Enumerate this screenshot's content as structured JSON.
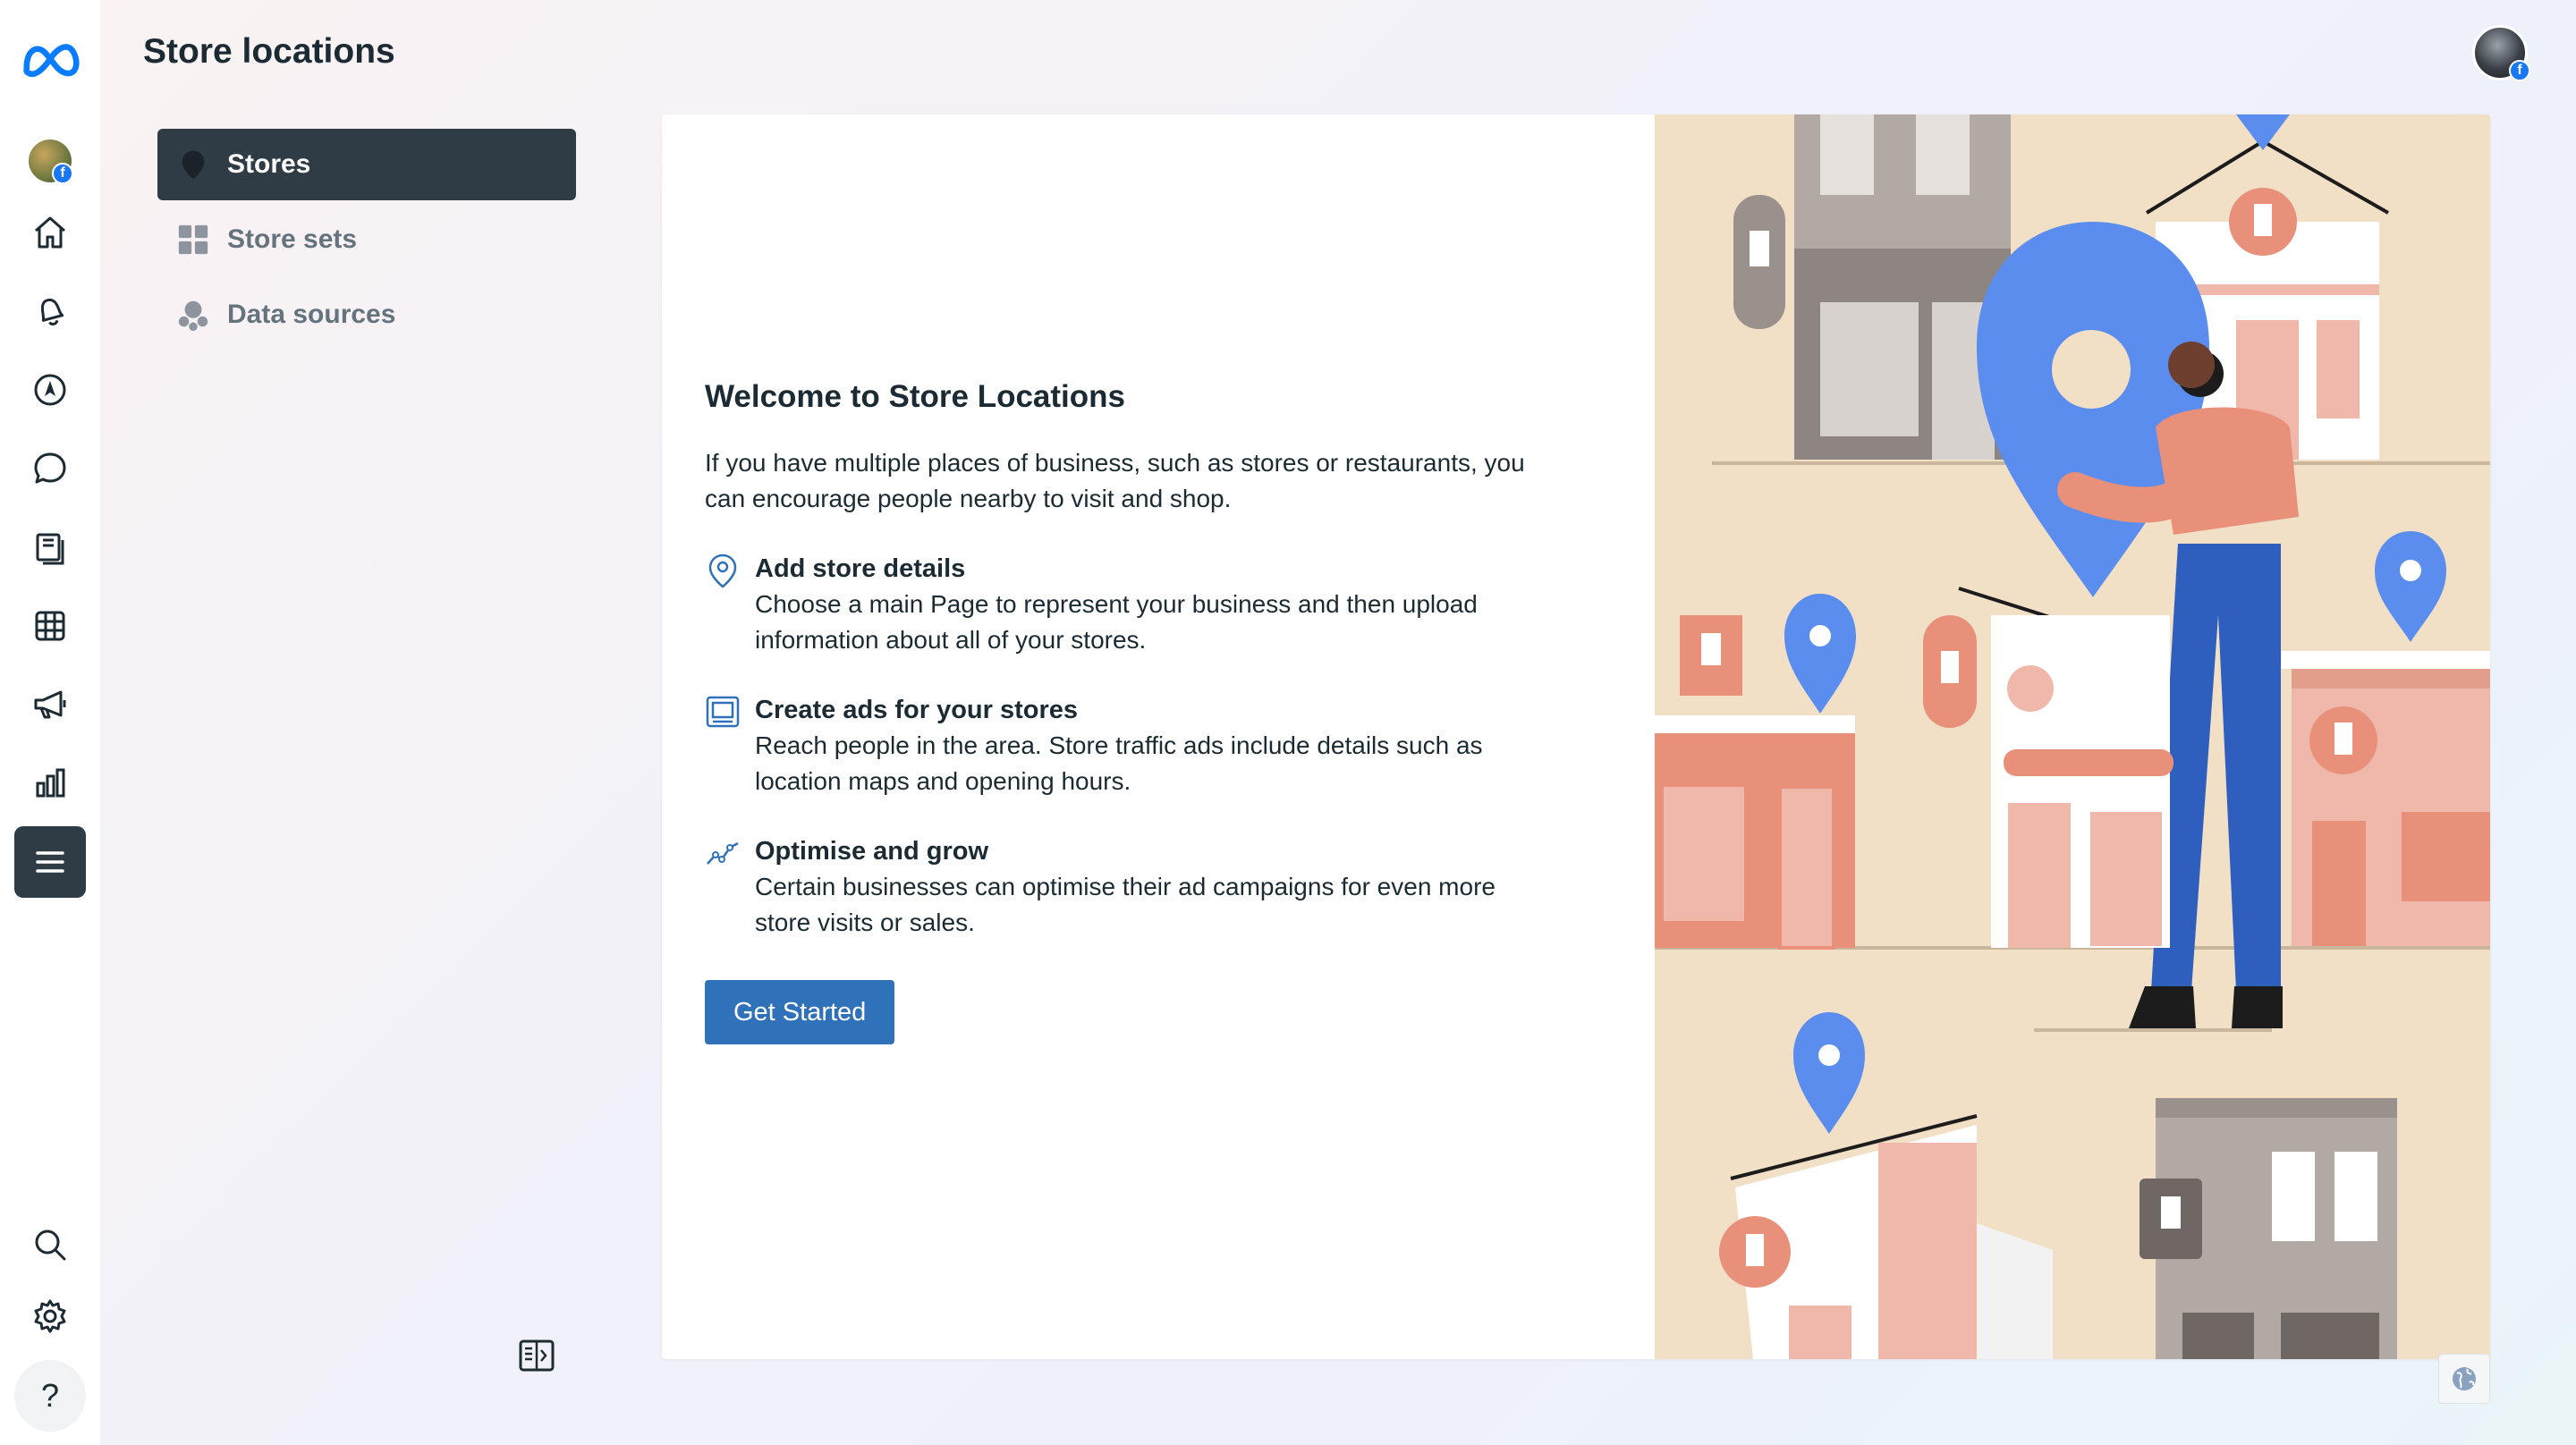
{
  "header": {
    "title": "Store locations"
  },
  "rail": {
    "items": [
      {
        "icon": "meta-logo-icon"
      },
      {
        "icon": "profile-avatar"
      },
      {
        "icon": "home-icon"
      },
      {
        "icon": "bell-icon"
      },
      {
        "icon": "navigation-compass-icon"
      },
      {
        "icon": "chat-bubble-icon"
      },
      {
        "icon": "pages-icon"
      },
      {
        "icon": "table-grid-icon"
      },
      {
        "icon": "megaphone-icon"
      },
      {
        "icon": "bar-chart-icon"
      },
      {
        "icon": "menu-icon",
        "active": true
      },
      {
        "icon": "search-icon"
      },
      {
        "icon": "gear-icon"
      }
    ],
    "help_label": "?"
  },
  "subnav": {
    "items": [
      {
        "label": "Stores",
        "icon": "location-pin-icon",
        "active": true
      },
      {
        "label": "Store sets",
        "icon": "grid-squares-icon",
        "active": false
      },
      {
        "label": "Data sources",
        "icon": "data-nodes-icon",
        "active": false
      }
    ]
  },
  "main": {
    "title": "Welcome to Store Locations",
    "intro": "If you have multiple places of business, such as stores or restaurants, you can encourage people nearby to visit and shop.",
    "features": [
      {
        "title": "Add store details",
        "description": "Choose a main Page to represent your business and then upload information about all of your stores.",
        "icon": "location-pin-outline-icon"
      },
      {
        "title": "Create ads for your stores",
        "description": "Reach people in the area. Store traffic ads include details such as location maps and opening hours.",
        "icon": "ad-screen-icon"
      },
      {
        "title": "Optimise and grow",
        "description": "Certain businesses can optimise their ad campaigns for even more store visits or sales.",
        "icon": "trend-line-icon"
      }
    ],
    "cta_label": "Get Started"
  },
  "colors": {
    "accent": "#3072b9",
    "nav_active": "#2f3b45",
    "illustration_bg": "#f1dfc6",
    "pin_blue": "#5b8def",
    "store_pink": "#e8907a"
  }
}
